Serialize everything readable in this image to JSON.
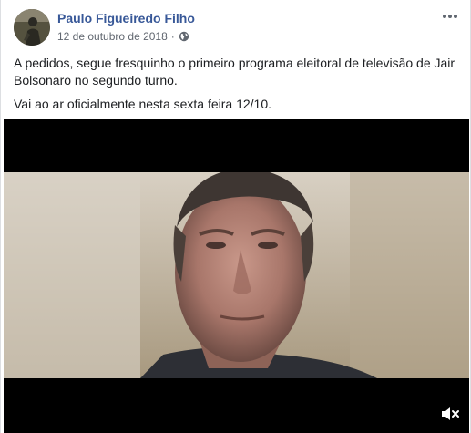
{
  "post": {
    "author": "Paulo Figueiredo Filho",
    "date": "12 de outubro de 2018",
    "separator": "·",
    "privacy_icon": "globe-icon",
    "more_icon": "more-options-icon",
    "paragraphs": [
      "A pedidos, segue fresquinho o primeiro programa eleitoral de televisão de Jair Bolsonaro no segundo turno.",
      "Vai ao ar oficialmente nesta sexta feira 12/10."
    ]
  },
  "video": {
    "mute_icon": "volume-muted-icon"
  },
  "colors": {
    "author": "#385898",
    "meta": "#616770",
    "text": "#1c1e21",
    "border": "#dddfe2"
  }
}
